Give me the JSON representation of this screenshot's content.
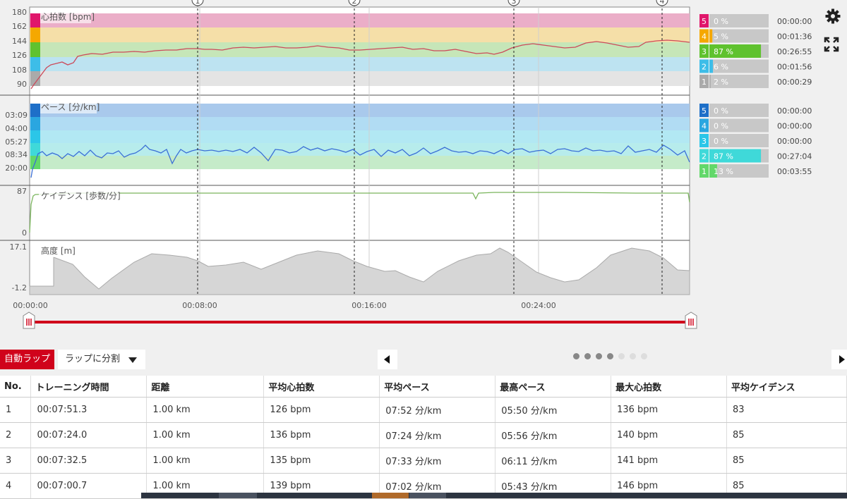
{
  "charts": {
    "heart_rate": {
      "title": "心拍数 [bpm]",
      "ticks": [
        "180",
        "162",
        "144",
        "126",
        "108",
        "90"
      ],
      "zones": [
        {
          "num": "5",
          "pct": "0 %",
          "frac": 0.0,
          "time": "00:00:00",
          "color": "#e0166b"
        },
        {
          "num": "4",
          "pct": "5 %",
          "frac": 0.05,
          "time": "00:01:36",
          "color": "#f5a800"
        },
        {
          "num": "3",
          "pct": "87 %",
          "frac": 0.87,
          "time": "00:26:55",
          "color": "#5fc22e"
        },
        {
          "num": "2",
          "pct": "6 %",
          "frac": 0.06,
          "time": "00:01:56",
          "color": "#3dbde8"
        },
        {
          "num": "1",
          "pct": "2 %",
          "frac": 0.02,
          "time": "00:00:29",
          "color": "#aaaaaa"
        }
      ]
    },
    "pace": {
      "title": "ペース [分/km]",
      "ticks": [
        "03:09",
        "04:00",
        "05:27",
        "08:34",
        "20:00"
      ],
      "zones": [
        {
          "num": "5",
          "pct": "0 %",
          "frac": 0.0,
          "time": "00:00:00",
          "color": "#1e6fc8"
        },
        {
          "num": "4",
          "pct": "0 %",
          "frac": 0.0,
          "time": "00:00:00",
          "color": "#2aa6e0"
        },
        {
          "num": "3",
          "pct": "0 %",
          "frac": 0.0,
          "time": "00:00:00",
          "color": "#2bc6e8"
        },
        {
          "num": "2",
          "pct": "87 %",
          "frac": 0.87,
          "time": "00:27:04",
          "color": "#3fd9d9"
        },
        {
          "num": "1",
          "pct": "13 %",
          "frac": 0.13,
          "time": "00:03:55",
          "color": "#62d86a"
        }
      ]
    },
    "cadence": {
      "title": "ケイデンス [歩数/分]",
      "ticks": [
        "87",
        "0"
      ]
    },
    "altitude": {
      "title": "高度 [m]",
      "ticks": [
        "17.1",
        "-1.2"
      ]
    },
    "x_ticks": [
      "00:00:00",
      "00:08:00",
      "00:16:00",
      "00:24:00"
    ],
    "lap_markers": [
      "1",
      "2",
      "3",
      "4"
    ]
  },
  "lap_controls": {
    "auto_lap": "自動ラップ",
    "split_lap": "ラップに分割"
  },
  "table": {
    "headers": [
      "No.",
      "トレーニング時間",
      "距離",
      "平均心拍数",
      "平均ペース",
      "最高ペース",
      "最大心拍数",
      "平均ケイデンス"
    ],
    "rows": [
      [
        "1",
        "00:07:51.3",
        "1.00 km",
        "126 bpm",
        "07:52 分/km",
        "05:50 分/km",
        "136 bpm",
        "83"
      ],
      [
        "2",
        "00:07:24.0",
        "1.00 km",
        "136 bpm",
        "07:24 分/km",
        "05:56 分/km",
        "140 bpm",
        "85"
      ],
      [
        "3",
        "00:07:32.5",
        "1.00 km",
        "135 bpm",
        "07:33 分/km",
        "06:11 分/km",
        "141 bpm",
        "85"
      ],
      [
        "4",
        "00:07:00.7",
        "1.00 km",
        "139 bpm",
        "07:02 分/km",
        "05:43 分/km",
        "146 bpm",
        "85"
      ]
    ]
  },
  "colors": {
    "accent": "#d0021b",
    "hr_line": "#cc4a5a",
    "pace_line": "#3b6fd6",
    "cad_line": "#7ab55c",
    "alt_fill": "#d6d6d6"
  },
  "icons": {
    "settings": "gear-icon",
    "fullscreen": "expand-icon"
  }
}
